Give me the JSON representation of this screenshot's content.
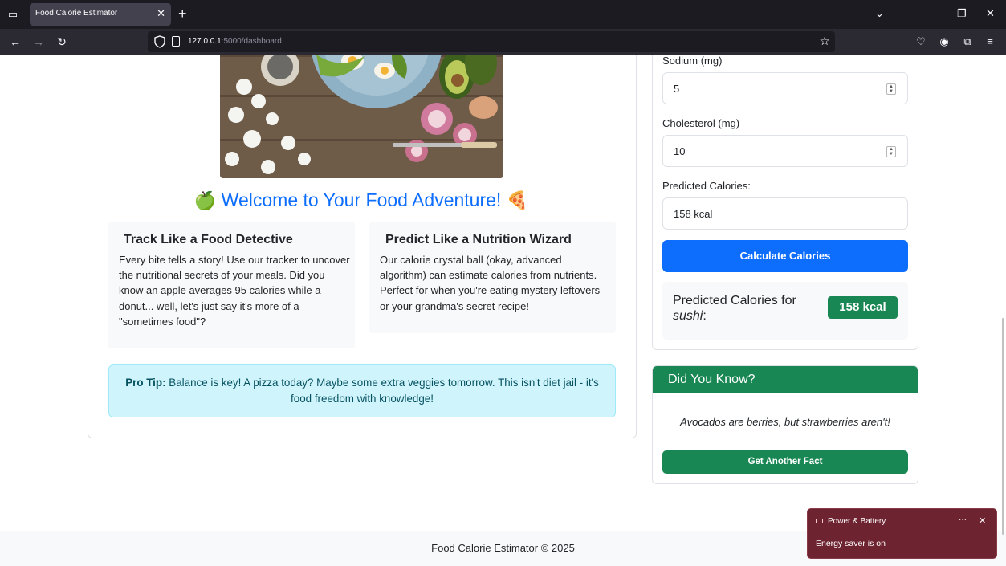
{
  "browser": {
    "tab_title": "Food Calorie Estimator",
    "url_host": "127.0.0.1",
    "url_path": ":5000/dashboard"
  },
  "main": {
    "welcome_text": "Welcome to Your Food Adventure!",
    "welcome_emoji_left": "🍏",
    "welcome_emoji_right": "🍕",
    "cards": [
      {
        "title": "Track Like a Food Detective",
        "body": "Every bite tells a story! Use our tracker to uncover the nutritional secrets of your meals. Did you know an apple averages 95 calories while a donut... well, let's just say it's more of a \"sometimes food\"?"
      },
      {
        "title": "Predict Like a Nutrition Wizard",
        "body": "Our calorie crystal ball (okay, advanced algorithm) can estimate calories from nutrients. Perfect for when you're eating mystery leftovers or your grandma's secret recipe!"
      }
    ],
    "tip_label": "Pro Tip:",
    "tip_text": "Balance is key! A pizza today? Maybe some extra veggies tomorrow. This isn't diet jail - it's food freedom with knowledge!"
  },
  "form": {
    "sodium_label": "Sodium (mg)",
    "sodium_value": "5",
    "cholesterol_label": "Cholesterol (mg)",
    "cholesterol_value": "10",
    "predicted_label": "Predicted Calories:",
    "predicted_value": "158 kcal",
    "calculate_button": "Calculate Calories",
    "result_prefix": "Predicted Calories for",
    "result_food": "sushi",
    "result_badge": "158 kcal"
  },
  "did_you_know": {
    "title": "Did You Know?",
    "fact": "Avocados are berries, but strawberries aren't!",
    "button": "Get Another Fact"
  },
  "footer": {
    "text": "Food Calorie Estimator © 2025"
  },
  "toast": {
    "title": "Power & Battery",
    "body": "Energy saver is on",
    "more": "···",
    "close": "✕"
  },
  "colors": {
    "primary": "#0d6efd",
    "success": "#198754",
    "info_bg": "#cff4fc",
    "browser_dark": "#1c1b22"
  }
}
